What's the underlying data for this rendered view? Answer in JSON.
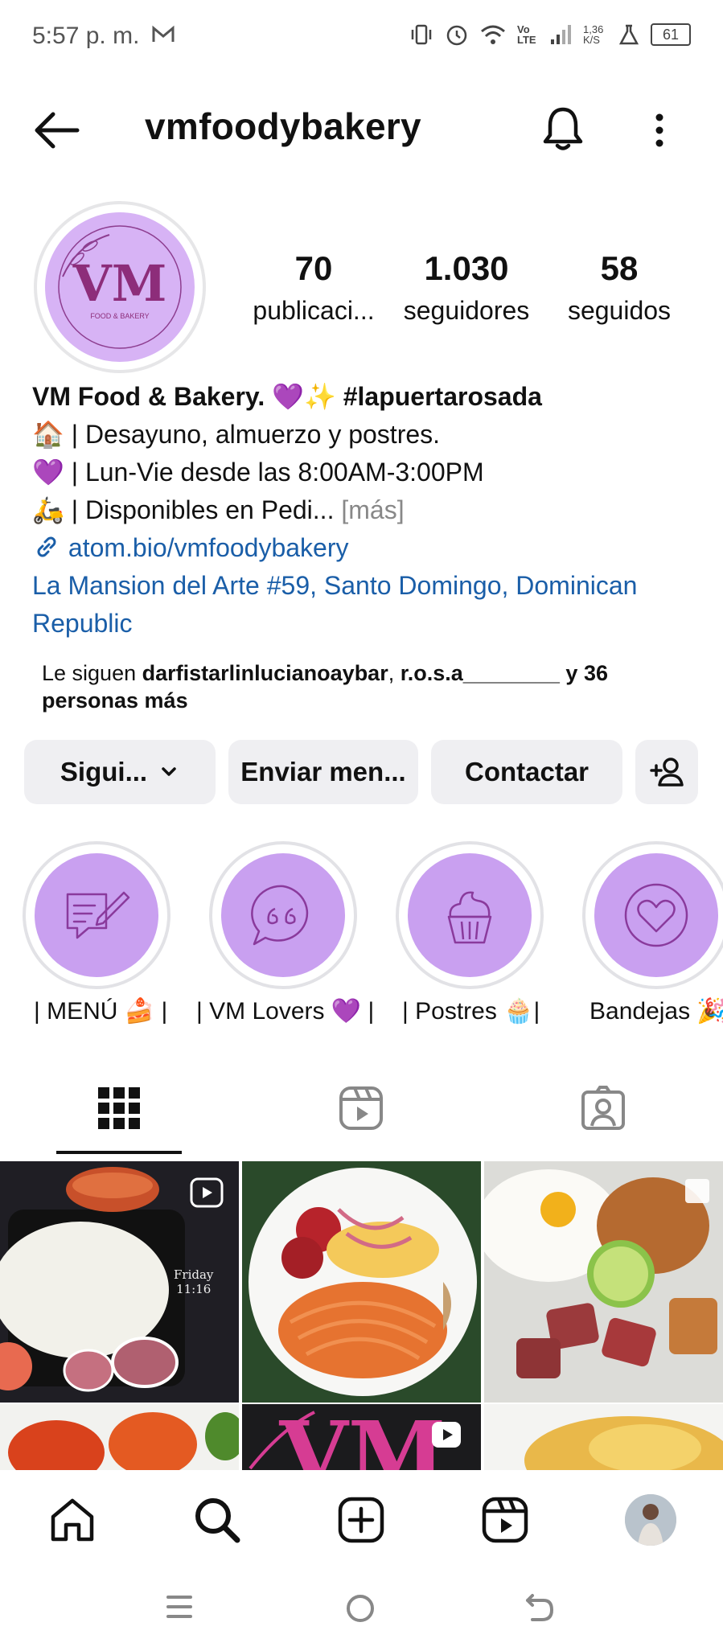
{
  "status_bar": {
    "time": "5:57 p. m.",
    "volte": "Vo LTE",
    "speed": "1,36 K/S",
    "battery": "61"
  },
  "header": {
    "username": "vmfoodybakery"
  },
  "avatar": {
    "monogram": "VM",
    "subtitle": "FOOD & BAKERY"
  },
  "stats": [
    {
      "value": "70",
      "label": "publicaci..."
    },
    {
      "value": "1.030",
      "label": "seguidores"
    },
    {
      "value": "58",
      "label": "seguidos"
    }
  ],
  "bio": {
    "name_line": "VM Food & Bakery. 💜✨ #lapuertarosada",
    "line1": "🏠 | Desayuno, almuerzo y postres.",
    "line2": "💜 | Lun-Vie desde las 8:00AM-3:00PM",
    "line3": "🛵 | Disponibles en Pedi...",
    "more": "[más]",
    "link": "atom.bio/vmfoodybakery",
    "location": "La Mansion del Arte #59, Santo Domingo, Dominican Republic"
  },
  "followed_by": {
    "prefix": "Le siguen ",
    "user1": "darfistarlinlucianoaybar",
    "sep": ", ",
    "user2": "r.o.s.a________",
    "suffix": " y 36 personas más"
  },
  "buttons": {
    "following": "Sigui...",
    "message": "Enviar men...",
    "contact": "Contactar"
  },
  "highlights": [
    {
      "label": "| MENÚ 🍰 |",
      "icon": "menu-chat-icon"
    },
    {
      "label": "| VM Lovers 💜 |",
      "icon": "quote-bubble-icon"
    },
    {
      "label": "| Postres 🧁|",
      "icon": "cupcake-icon"
    },
    {
      "label": "Bandejas 🎉",
      "icon": "heart-circle-icon"
    }
  ],
  "grid_overlays": {
    "post1_date": "Friday",
    "post1_time": "11:16"
  },
  "colors": {
    "accent_purple": "#c9a0f0",
    "link_blue": "#1a5ea8",
    "button_bg": "#efeff2"
  }
}
